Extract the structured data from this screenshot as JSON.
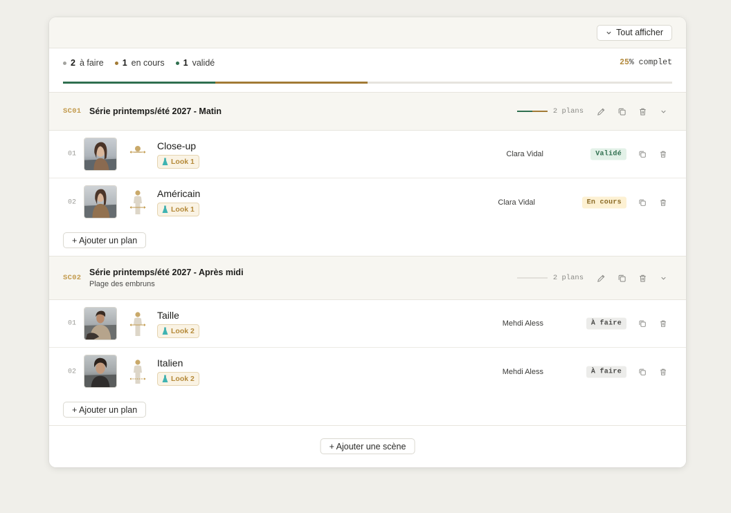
{
  "toolbar": {
    "show_all_label": "Tout afficher"
  },
  "summary": {
    "counts": [
      {
        "value": "2",
        "label": "à faire",
        "color": "#a3a39f"
      },
      {
        "value": "1",
        "label": "en cours",
        "color": "#a27a35"
      },
      {
        "value": "1",
        "label": "validé",
        "color": "#2f6f4f"
      }
    ],
    "percent": "25",
    "percent_suffix": "% complet",
    "progress": {
      "validated_fraction": 0.25,
      "in_progress_fraction": 0.25
    }
  },
  "colors": {
    "validated": "#2f6f4f",
    "in_progress": "#a27a35",
    "todo": "#a3a39f",
    "accent": "#c29a4c"
  },
  "scenes": [
    {
      "code": "SC01",
      "title": "Série printemps/été 2027 - Matin",
      "subtitle": "",
      "plans": "2 plans",
      "progress": {
        "validated_fraction": 0.5,
        "in_progress_fraction": 0.5
      },
      "shots": [
        {
          "num": "01",
          "name": "Close-up",
          "look": "Look 1",
          "assignee": "Clara Vidal",
          "status": "Validé",
          "status_type": "validated",
          "framing_icon": "close-up-framing-icon"
        },
        {
          "num": "02",
          "name": "Américain",
          "look": "Look 1",
          "assignee": "Clara Vidal",
          "status": "En cours",
          "status_type": "in_progress",
          "framing_icon": "american-framing-icon"
        }
      ],
      "add_shot_label": "+ Ajouter un plan"
    },
    {
      "code": "SC02",
      "title": "Série printemps/été 2027 - Après midi",
      "subtitle": "Plage des embruns",
      "plans": "2 plans",
      "progress": {
        "validated_fraction": 0,
        "in_progress_fraction": 0
      },
      "shots": [
        {
          "num": "01",
          "name": "Taille",
          "look": "Look 2",
          "assignee": "Mehdi Aless",
          "status": "À faire",
          "status_type": "todo",
          "framing_icon": "waist-framing-icon"
        },
        {
          "num": "02",
          "name": "Italien",
          "look": "Look 2",
          "assignee": "Mehdi Aless",
          "status": "À faire",
          "status_type": "todo",
          "framing_icon": "knee-framing-icon"
        }
      ],
      "add_shot_label": "+ Ajouter un plan"
    }
  ],
  "footer": {
    "add_scene_label": "+ Ajouter une scène"
  }
}
